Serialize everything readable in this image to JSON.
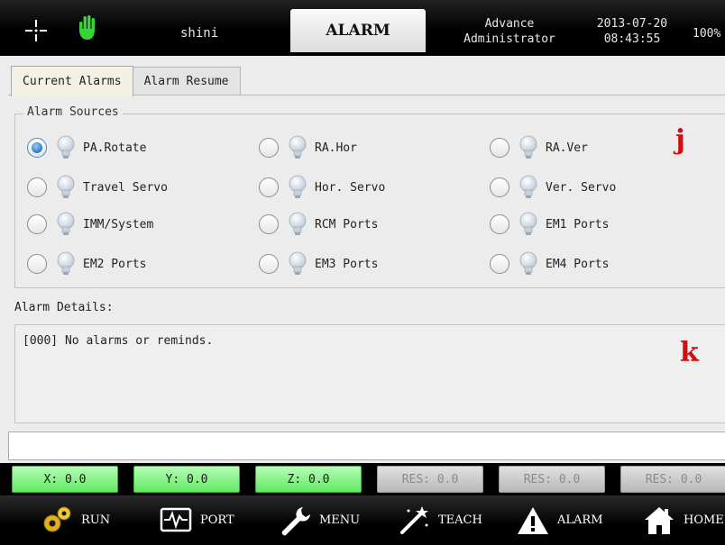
{
  "header": {
    "user": "shini",
    "title": "ALARM",
    "role_line1": "Advance",
    "role_line2": "Administrator",
    "date": "2013-07-20",
    "time": "08:43:55",
    "percent": "100%"
  },
  "tabs": [
    {
      "label": "Current Alarms",
      "active": true
    },
    {
      "label": "Alarm Resume",
      "active": false
    }
  ],
  "alarm_sources": {
    "title": "Alarm Sources",
    "selected": "PA.Rotate",
    "items": [
      {
        "label": "PA.Rotate"
      },
      {
        "label": "RA.Hor"
      },
      {
        "label": "RA.Ver"
      },
      {
        "label": "Travel Servo"
      },
      {
        "label": "Hor. Servo"
      },
      {
        "label": "Ver. Servo"
      },
      {
        "label": "IMM/System"
      },
      {
        "label": "RCM Ports"
      },
      {
        "label": "EM1 Ports"
      },
      {
        "label": "EM2 Ports"
      },
      {
        "label": "EM3 Ports"
      },
      {
        "label": "EM4 Ports"
      }
    ]
  },
  "markers": {
    "j": "j",
    "k": "k"
  },
  "alarm_details": {
    "label": "Alarm Details:",
    "text": "[000] No alarms or reminds."
  },
  "coords": [
    {
      "text": "X: 0.0",
      "active": true
    },
    {
      "text": "Y: 0.0",
      "active": true
    },
    {
      "text": "Z: 0.0",
      "active": true
    },
    {
      "text": "RES: 0.0",
      "active": false
    },
    {
      "text": "RES: 0.0",
      "active": false
    },
    {
      "text": "RES: 0.0",
      "active": false
    }
  ],
  "nav": [
    {
      "label": "RUN",
      "icon": "gears-icon"
    },
    {
      "label": "PORT",
      "icon": "monitor-icon"
    },
    {
      "label": "MENU",
      "icon": "wrench-icon"
    },
    {
      "label": "TEACH",
      "icon": "magic-wand-icon"
    },
    {
      "label": "ALARM",
      "icon": "warning-icon"
    },
    {
      "label": "HOME",
      "icon": "home-icon"
    }
  ],
  "colors": {
    "coord_active": "#62e862",
    "coord_inactive": "#b8b8b8",
    "marker": "#d01010",
    "radio_selected": "#2b78c9"
  }
}
